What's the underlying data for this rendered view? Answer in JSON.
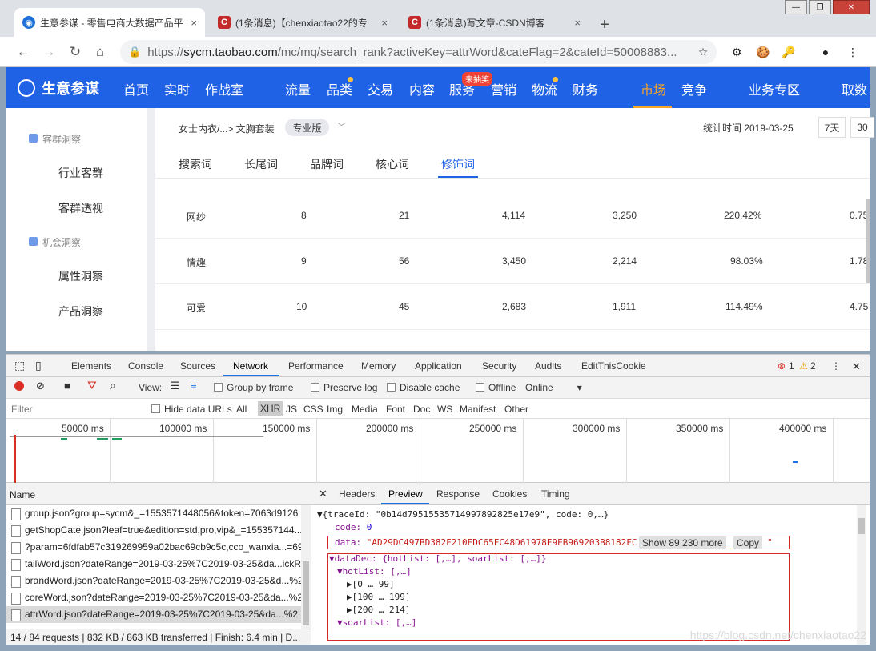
{
  "tabs": [
    {
      "title": "生意参谋 - 零售电商大数据产品平",
      "close": "×"
    },
    {
      "title": "(1条消息)【chenxiaotao22的专",
      "close": "×"
    },
    {
      "title": "(1条消息)写文章-CSDN博客",
      "close": "×"
    }
  ],
  "new_tab": "+",
  "window_buttons": {
    "min": "—",
    "max": "❐",
    "close": "✕"
  },
  "url": {
    "scheme": "https://",
    "host": "sycm.taobao.com",
    "path": "/mc/mq/search_rank?activeKey=attrWord&cateFlag=2&cateId=50008883..."
  },
  "site_header": {
    "logo": "生意参谋",
    "menu": [
      "首页",
      "实时",
      "作战室",
      "流量",
      "品类",
      "交易",
      "内容",
      "服务",
      "营销",
      "物流",
      "财务",
      "市场",
      "竞争",
      "业务专区",
      "取数"
    ],
    "active": "市场",
    "promo_badge": "来抽奖"
  },
  "sidebar": {
    "groups": [
      "客群洞察",
      "机会洞察"
    ],
    "items": [
      "行业客群",
      "客群透视",
      "属性洞察",
      "产品洞察"
    ]
  },
  "breadcrumb": "女士内衣/...> 文胸套装",
  "edition_badge": "专业版",
  "stat_time": "统计时间 2019-03-25",
  "date_buttons": [
    "7天",
    "30"
  ],
  "subtabs": [
    "搜索词",
    "长尾词",
    "品牌词",
    "核心词",
    "修饰词"
  ],
  "active_subtab": "修饰词",
  "table_rows": [
    {
      "word": "网纱",
      "c1": "8",
      "c2": "21",
      "c3": "4,114",
      "c4": "3,250",
      "c5": "220.42%",
      "c6": "0.75"
    },
    {
      "word": "情趣",
      "c1": "9",
      "c2": "56",
      "c3": "3,450",
      "c4": "2,214",
      "c5": "98.03%",
      "c6": "1.78"
    },
    {
      "word": "可爱",
      "c1": "10",
      "c2": "45",
      "c3": "2,683",
      "c4": "1,911",
      "c5": "114.49%",
      "c6": "4.75"
    }
  ],
  "devtools": {
    "tabs": [
      "Elements",
      "Console",
      "Sources",
      "Network",
      "Performance",
      "Memory",
      "Application",
      "Security",
      "Audits",
      "EditThisCookie"
    ],
    "active_tab": "Network",
    "errors": "1",
    "warnings": "2",
    "toolbar": {
      "view": "View:",
      "group_by_frame": "Group by frame",
      "preserve_log": "Preserve log",
      "disable_cache": "Disable cache",
      "offline": "Offline",
      "online": "Online"
    },
    "filter_placeholder": "Filter",
    "hide_data_urls": "Hide data URLs",
    "filter_types": [
      "All",
      "XHR",
      "JS",
      "CSS",
      "Img",
      "Media",
      "Font",
      "Doc",
      "WS",
      "Manifest",
      "Other"
    ],
    "active_filter": "XHR",
    "timeline_labels": [
      "50000 ms",
      "100000 ms",
      "150000 ms",
      "200000 ms",
      "250000 ms",
      "300000 ms",
      "350000 ms",
      "400000 ms"
    ],
    "name_header": "Name",
    "requests": [
      "group.json?group=sycm&_=1553571448056&token=7063d9126",
      "getShopCate.json?leaf=true&edition=std,pro,vip&_=155357144...",
      "?param=6fdfab57c319269959a02bac69cb9c5c,cco_wanxia...=69",
      "tailWord.json?dateRange=2019-03-25%7C2019-03-25&da...ickR",
      "brandWord.json?dateRange=2019-03-25%7C2019-03-25&d...%2",
      "coreWord.json?dateRange=2019-03-25%7C2019-03-25&da...%2",
      "attrWord.json?dateRange=2019-03-25%7C2019-03-25&da...%2"
    ],
    "selected_request": 6,
    "status": "14 / 84 requests  |  832 KB / 863 KB transferred  |  Finish: 6.4 min  |  D...",
    "preview_tabs": [
      "Headers",
      "Preview",
      "Response",
      "Cookies",
      "Timing"
    ],
    "active_preview_tab": "Preview",
    "preview": {
      "line1": "▼{traceId: \"0b14d79515535714997892825e17e9\", code: 0,…}",
      "code_key": "code:",
      "code_val": "0",
      "data_key": "data:",
      "data_val": "\"AD29DC497BD382F210EDC65FC48D61978E9EB969203B8182FC",
      "show_more": "Show 89 230 more",
      "copy": "Copy",
      "quote": "\"",
      "datadec": "▼dataDec: {hotList: [,…], soarList: [,…]}",
      "hotlist": "▼hotList: [,…]",
      "ranges": [
        "▶[0 … 99]",
        "▶[100 … 199]",
        "▶[200 … 214]"
      ],
      "soarlist": "▼soarList: [,…]"
    }
  },
  "watermark": "https://blog.csdn.net/chenxiaotao22"
}
